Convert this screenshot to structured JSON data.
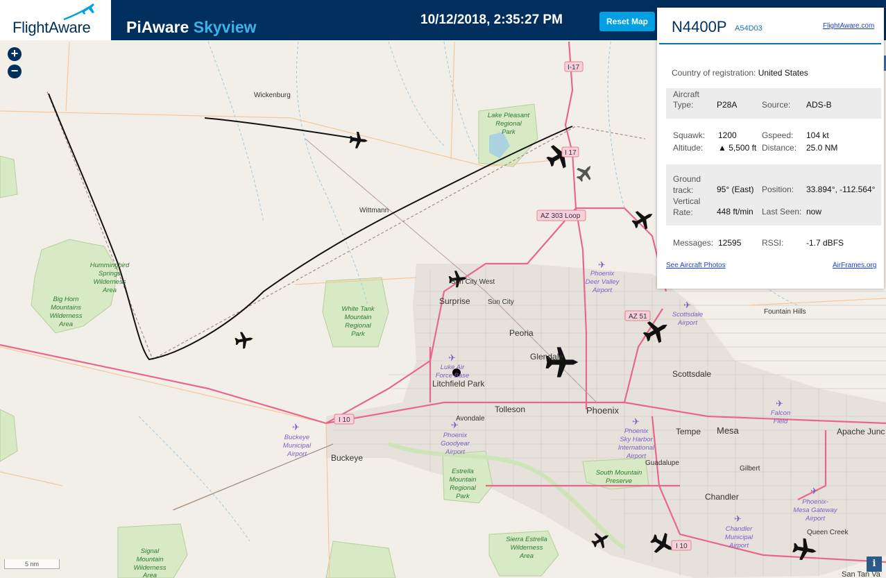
{
  "header": {
    "logo_text": "FlightAware",
    "title_main": "PiAware",
    "title_accent": "Skyview",
    "clock": "10/12/2018, 2:35:27 PM",
    "reset_label": "Reset Map"
  },
  "map": {
    "zoom_in": "+",
    "zoom_out": "−",
    "scale_label": "5 nm",
    "info_label": "i",
    "places": {
      "wickenburg": "Wickenburg",
      "wittmann": "Wittmann",
      "surprise": "Surprise",
      "sun_city": "Sun City",
      "sun_city_west": "Sun City West",
      "peoria": "Peoria",
      "glendale": "Glendale",
      "litchfield_park": "Litchfield Park",
      "tolleson": "Tolleson",
      "avondale": "Avondale",
      "phoenix": "Phoenix",
      "tempe": "Tempe",
      "mesa": "Mesa",
      "scottsdale": "Scottsdale",
      "fountain_hills": "Fountain Hills",
      "apache_junction": "Apache Junc",
      "gilbert": "Gilbert",
      "chandler": "Chandler",
      "guadalupe": "Guadalupe",
      "buckeye": "Buckeye",
      "queen_creek": "Queen Creek",
      "san_tan_valley": "San Tan Va"
    },
    "parks": {
      "lake_pleasant": [
        "Lake Pleasant",
        "Regional",
        "Park"
      ],
      "hummingbird": [
        "Hummingbird",
        "Springs",
        "Wilderness",
        "Area"
      ],
      "big_horn": [
        "Big Horn",
        "Mountains",
        "Wilderness",
        "Area"
      ],
      "white_tank": [
        "White Tank",
        "Mountain",
        "Regional",
        "Park"
      ],
      "estrella": [
        "Estrella",
        "Mountain",
        "Regional",
        "Park"
      ],
      "south_mountain": [
        "South Mountain",
        "Preserve"
      ],
      "sierra_estrella": [
        "Sierra Estrella",
        "Wilderness",
        "Area"
      ],
      "signal_mountain": [
        "Signal",
        "Mountain",
        "Wilderness",
        "Area"
      ]
    },
    "airports": {
      "deer_valley": [
        "Phoenix",
        "Deer Valley",
        "Airport"
      ],
      "scottsdale": [
        "Scottsdale",
        "Airport"
      ],
      "luke": [
        "Luke Air",
        "Force Base"
      ],
      "goodyear": [
        "Phoenix",
        "Goodyear",
        "Airport"
      ],
      "buckeye": [
        "Buckeye",
        "Municipal",
        "Airport"
      ],
      "sky_harbor": [
        "Phoenix",
        "Sky Harbor",
        "International",
        "Airport"
      ],
      "falcon": [
        "Falcon",
        "Field"
      ],
      "mesa_gateway": [
        "Phoenix-",
        "Mesa Gateway",
        "Airport"
      ],
      "chandler": [
        "Chandler",
        "Municipal",
        "Airport"
      ]
    },
    "shields": {
      "i17_north": "I-17",
      "i17_south": "I 17",
      "az303": "AZ 303 Loop",
      "az51": "AZ 51",
      "i10_west": "I 10",
      "i10_east": "I 10"
    }
  },
  "panel": {
    "callsign": "N4400P",
    "icao": "A54D03",
    "fa_link": "FlightAware.com",
    "country_label": "Country of registration:",
    "country_value": "United States",
    "aircraft_type_label_1": "Aircraft",
    "aircraft_type_label_2": "Type:",
    "aircraft_type_value": "P28A",
    "source_label": "Source:",
    "source_value": "ADS-B",
    "squawk_label": "Squawk:",
    "squawk_value": "1200",
    "gspeed_label": "Gspeed:",
    "gspeed_value": "104 kt",
    "altitude_label": "Altitude:",
    "altitude_value": "▲ 5,500 ft",
    "distance_label": "Distance:",
    "distance_value": "25.0 NM",
    "track_label_1": "Ground",
    "track_label_2": "track:",
    "track_value": "95° (East)",
    "position_label": "Position:",
    "position_value": "33.894°, -112.564°",
    "vrate_label_1": "Vertical",
    "vrate_label_2": "Rate:",
    "vrate_value": "448 ft/min",
    "lastseen_label": "Last Seen:",
    "lastseen_value": "now",
    "messages_label": "Messages:",
    "messages_value": "12595",
    "rssi_label": "RSSI:",
    "rssi_value": "-1.7 dBFS",
    "photos_link": "See Aircraft Photos",
    "airframes_link": "AirFrames.org"
  },
  "colors": {
    "header_bg": "#002f5d",
    "accent": "#3ab4e8",
    "button": "#00a0e2",
    "highway": "#e8678c",
    "panel_rule": "#0a74a6"
  }
}
